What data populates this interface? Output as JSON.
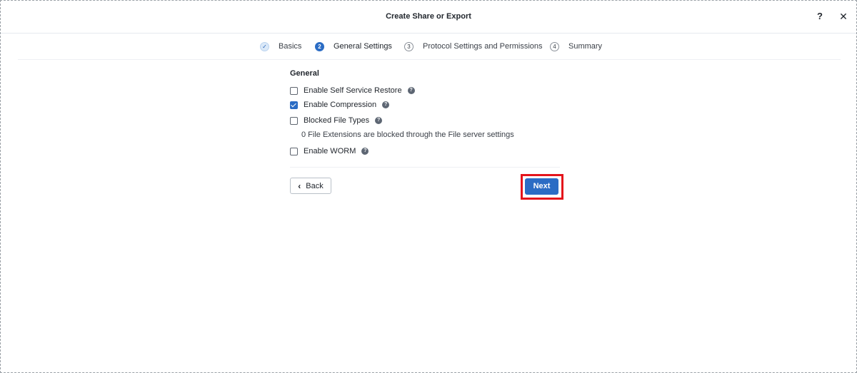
{
  "dialog": {
    "title": "Create Share or Export",
    "help_label": "?",
    "close_label": "✕"
  },
  "stepper": {
    "steps": [
      {
        "number": "✓",
        "label": "Basics",
        "state": "completed"
      },
      {
        "number": "2",
        "label": "General Settings",
        "state": "active"
      },
      {
        "number": "3",
        "label": "Protocol Settings and Permissions",
        "state": "pending"
      },
      {
        "number": "4",
        "label": "Summary",
        "state": "pending"
      }
    ]
  },
  "general": {
    "section_title": "General",
    "options": [
      {
        "label": "Enable Self Service Restore",
        "checked": false,
        "help_icon": "question-circle-icon"
      },
      {
        "label": "Enable Compression",
        "checked": true,
        "help_icon": "question-circle-icon"
      },
      {
        "label": "Blocked File Types",
        "checked": false,
        "help_icon": "question-circle-icon"
      },
      {
        "label": "Enable WORM",
        "checked": false,
        "help_icon": "question-circle-icon"
      }
    ],
    "blocked_note": "0 File Extensions are blocked through the File server settings",
    "help_glyph": "?"
  },
  "footer": {
    "back_label": "Back",
    "back_icon": "chevron-left-icon",
    "next_label": "Next"
  },
  "colors": {
    "primary": "#2b6cc4",
    "highlight": "#e4141b"
  }
}
